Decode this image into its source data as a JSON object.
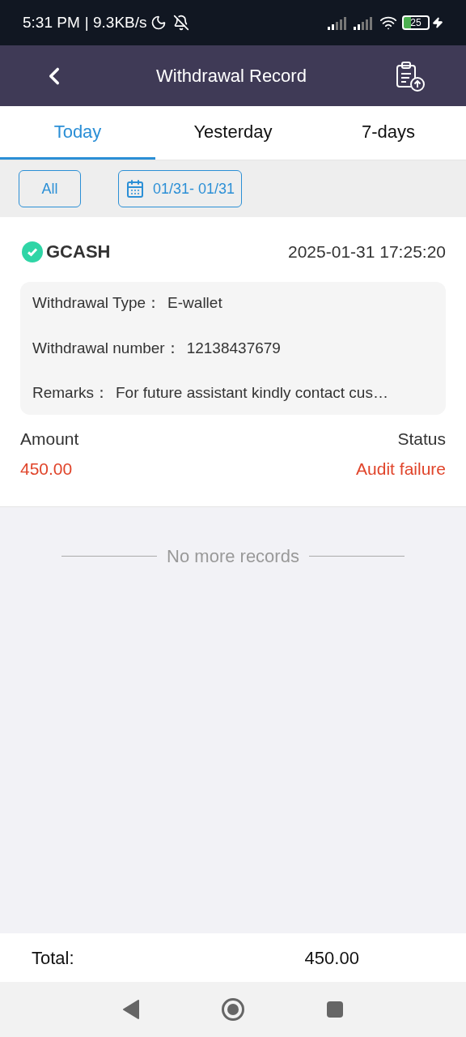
{
  "status_bar": {
    "time": "5:31 PM",
    "speed": "| 9.3KB/s",
    "battery": "25"
  },
  "header": {
    "title": "Withdrawal Record"
  },
  "tabs": [
    {
      "label": "Today",
      "selected": true
    },
    {
      "label": "Yesterday",
      "selected": false
    },
    {
      "label": "7-days",
      "selected": false
    }
  ],
  "filters": {
    "type": "All",
    "date_range": "01/31- 01/31"
  },
  "records": [
    {
      "method": "GCASH",
      "time": "2025-01-31 17:25:20",
      "details": [
        {
          "label": "Withdrawal Type：",
          "value": "E-wallet"
        },
        {
          "label": "Withdrawal number：",
          "value": "12138437679"
        },
        {
          "label": "Remarks：",
          "value": "For future assistant kindly contact cus…"
        }
      ],
      "amount_label": "Amount",
      "amount": "450.00",
      "status_label": "Status",
      "status": "Audit failure"
    }
  ],
  "end_note": "No more records",
  "footer": {
    "label": "Total:",
    "value": "450.00"
  }
}
